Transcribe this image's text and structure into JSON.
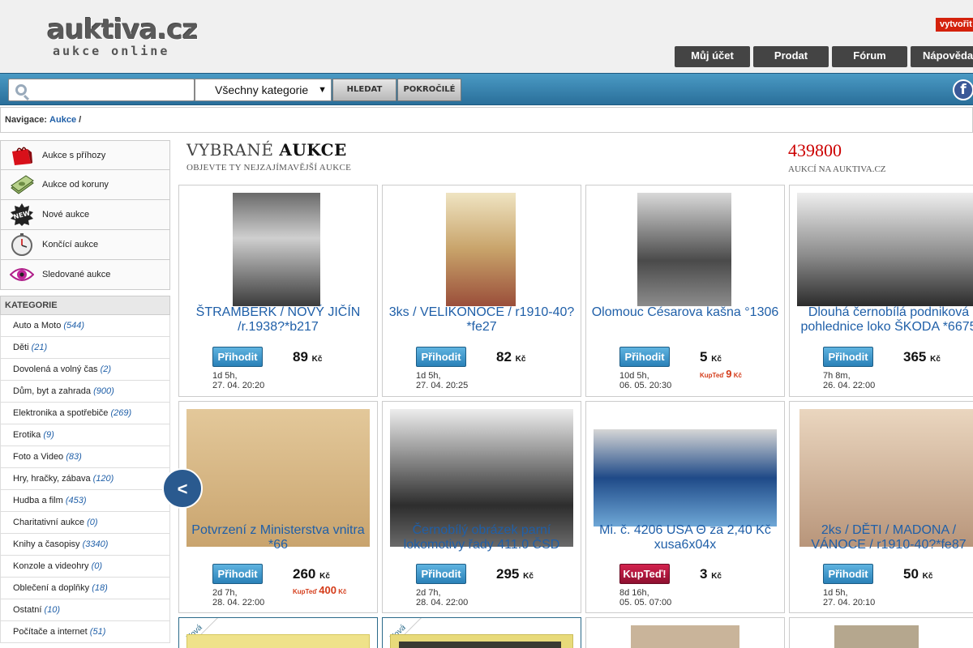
{
  "header": {
    "logo_main": "auktiva.cz",
    "logo_sub": "aukce online",
    "create_label": "vytvořit",
    "nav": [
      "Můj účet",
      "Prodat",
      "Fórum",
      "Nápověda"
    ]
  },
  "search": {
    "placeholder": "",
    "category_selected": "Všechny kategorie",
    "search_label": "HLEDAT",
    "advanced_label": "POKROČILÉ",
    "facebook_label": "f"
  },
  "breadcrumb": {
    "label": "Navigace:",
    "link": "Aukce",
    "sep": "/"
  },
  "sidebar": {
    "items": [
      {
        "label": "Aukce s příhozy",
        "icon": "shopping-bag-icon"
      },
      {
        "label": "Aukce od koruny",
        "icon": "money-icon"
      },
      {
        "label": "Nové aukce",
        "icon": "new-badge-icon"
      },
      {
        "label": "Končící aukce",
        "icon": "stopwatch-icon"
      },
      {
        "label": "Sledované aukce",
        "icon": "eye-icon"
      }
    ],
    "categories_title": "KATEGORIE",
    "categories": [
      {
        "name": "Auto a Moto",
        "count": "(544)"
      },
      {
        "name": "Děti",
        "count": "(21)"
      },
      {
        "name": "Dovolená a volný čas",
        "count": "(2)"
      },
      {
        "name": "Dům, byt a zahrada",
        "count": "(900)"
      },
      {
        "name": "Elektronika a spotřebiče",
        "count": "(269)"
      },
      {
        "name": "Erotika",
        "count": "(9)"
      },
      {
        "name": "Foto a Video",
        "count": "(83)"
      },
      {
        "name": "Hry, hračky, zábava",
        "count": "(120)"
      },
      {
        "name": "Hudba a film",
        "count": "(453)"
      },
      {
        "name": "Charitativní aukce",
        "count": "(0)"
      },
      {
        "name": "Knihy a časopisy",
        "count": "(3340)"
      },
      {
        "name": "Konzole a videohry",
        "count": "(0)"
      },
      {
        "name": "Oblečení a doplňky",
        "count": "(18)"
      },
      {
        "name": "Ostatní",
        "count": "(10)"
      },
      {
        "name": "Počítače a internet",
        "count": "(51)"
      }
    ]
  },
  "main": {
    "title_light": "VYBRANÉ",
    "title_bold": "AUKCE",
    "subtitle": "OBJEVTE TY NEJZAJÍMAVĚJŠÍ AUKCE",
    "count": "439800",
    "count_sub": "AUKCÍ NA AUKTIVA.CZ",
    "prev_label": "<",
    "currency": "Kč",
    "buynow_label": "KupTeď",
    "new_label": "Nová",
    "auctions": [
      {
        "title": "ŠTRAMBERK / NOVÝ JIČÍN /r.1938?*b217",
        "button": "Přihodit",
        "price": "89",
        "buynow": "",
        "time_left": "1d 5h,",
        "end": "27. 04. 20:20"
      },
      {
        "title": "3ks / VELIKONOCE / r1910-40?*fe27",
        "button": "Přihodit",
        "price": "82",
        "buynow": "",
        "time_left": "1d 5h,",
        "end": "27. 04. 20:25"
      },
      {
        "title": "Olomouc Césarova kašna °1306",
        "button": "Přihodit",
        "price": "5",
        "buynow": "9",
        "time_left": "10d 5h,",
        "end": "06. 05. 20:30"
      },
      {
        "title": "Dlouhá černobílá podniková pohlednice loko ŠKODA *6675",
        "button": "Přihodit",
        "price": "365",
        "buynow": "",
        "time_left": "7h 8m,",
        "end": "26. 04. 22:00"
      },
      {
        "title": "Potvrzení z Ministerstva vnitra *66",
        "button": "Přihodit",
        "price": "260",
        "buynow": "400",
        "time_left": "2d 7h,",
        "end": "28. 04. 22:00"
      },
      {
        "title": "Černobílý obrázek parní lokomotivy řady 411.0 ČSD",
        "button": "Přihodit",
        "price": "295",
        "buynow": "",
        "time_left": "2d 7h,",
        "end": "28. 04. 22:00"
      },
      {
        "title": "Mi. č. 4206 USA Θ za 2,40 Kč xusa6x04x",
        "button": "KupTeď!",
        "price": "3",
        "buynow": "",
        "time_left": "8d 16h,",
        "end": "05. 05. 07:00"
      },
      {
        "title": "2ks / DĚTI / MADONA / VÁNOCE / r1910-40?*fe87",
        "button": "Přihodit",
        "price": "50",
        "buynow": "",
        "time_left": "1d 5h,",
        "end": "27. 04. 20:10"
      }
    ]
  },
  "colors": {
    "link": "#1f5fa8",
    "count": "#cc0000",
    "search_bar": "#2a6f9a",
    "bid_button": "#2a81b8",
    "kupted_button": "#8e1030",
    "create_button": "#d4220c"
  }
}
